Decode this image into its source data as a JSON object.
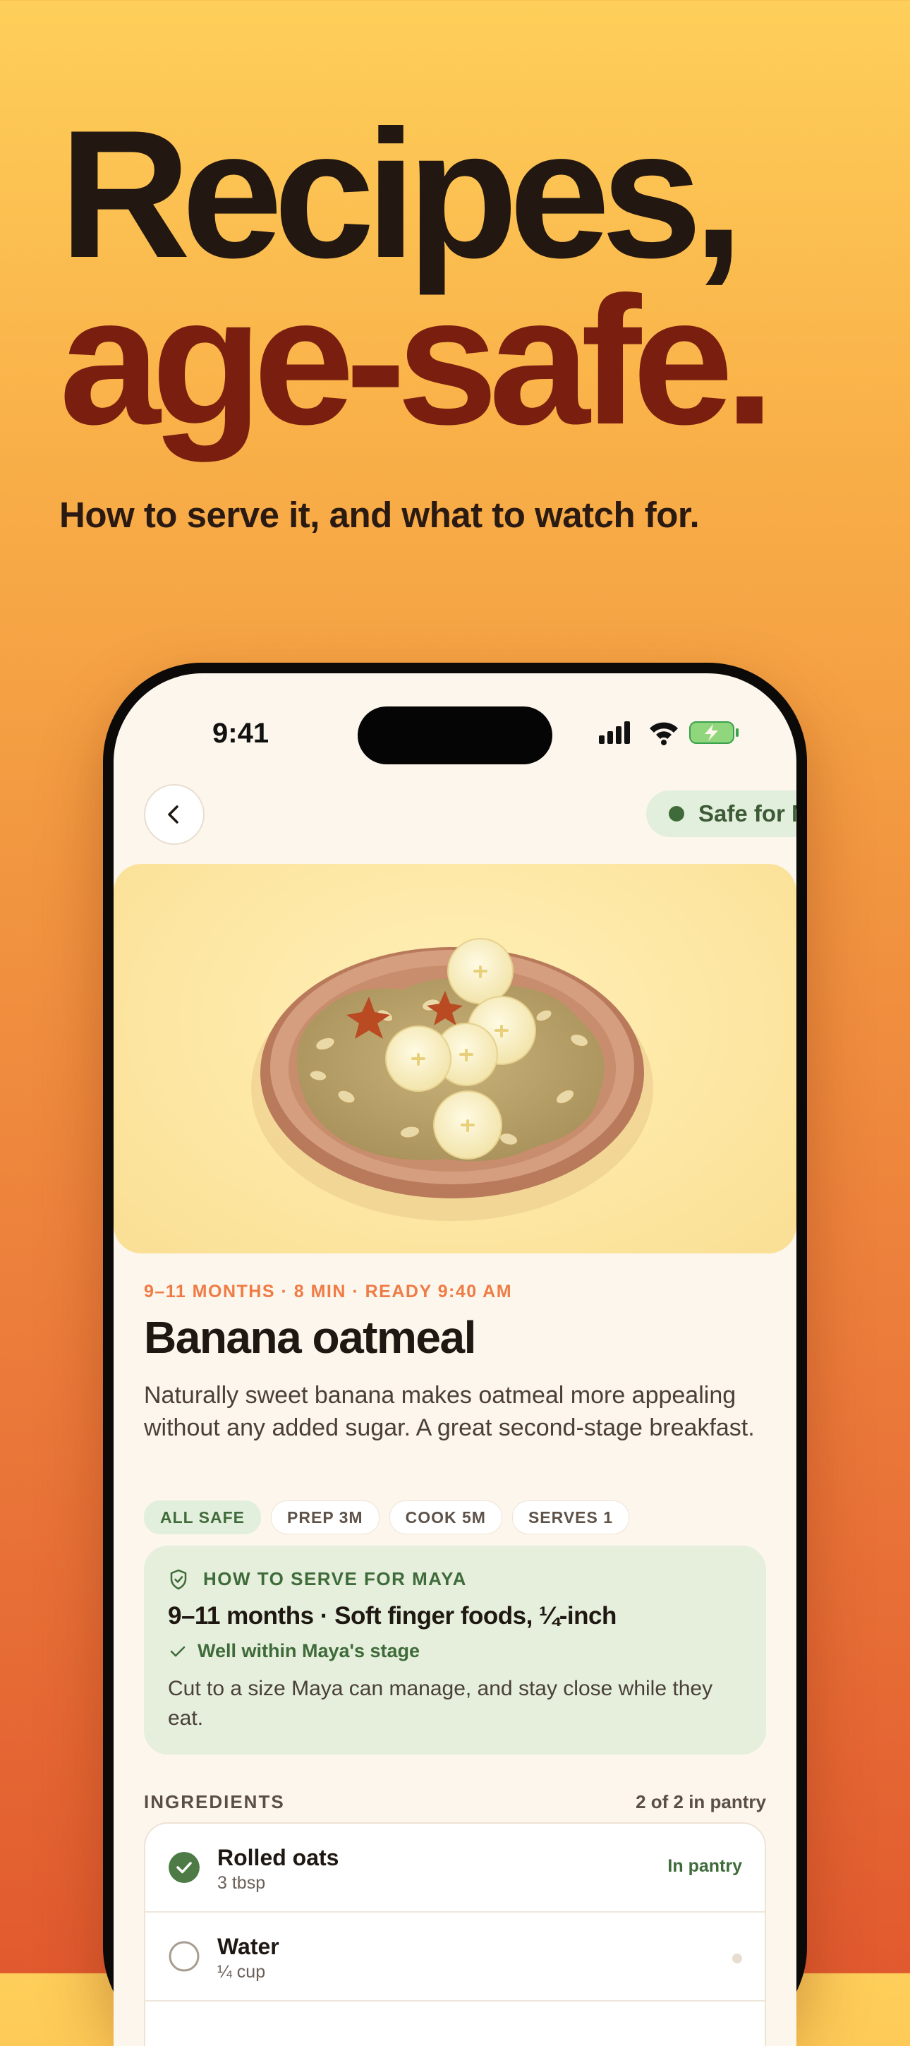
{
  "promo": {
    "headline_line1": "Recipes,",
    "headline_line2": "age-safe.",
    "subhead": "How to serve it, and what to watch for."
  },
  "status_bar": {
    "time": "9:41"
  },
  "nav": {
    "safe_badge": "Safe for Maya"
  },
  "recipe": {
    "meta": "9–11 MONTHS · 8 MIN · READY 9:40 AM",
    "title": "Banana oatmeal",
    "description": "Naturally sweet banana makes oatmeal more appealing without any added sugar. A great second-stage breakfast.",
    "chips": [
      "ALL SAFE",
      "PREP 3M",
      "COOK 5M",
      "SERVES 1"
    ]
  },
  "serve_card": {
    "heading": "HOW TO SERVE FOR MAYA",
    "title": "9–11 months · Soft finger foods, ¼-inch",
    "check": "Well within Maya's stage",
    "body": "Cut to a size Maya can manage, and stay close while they eat."
  },
  "ingredients": {
    "label": "INGREDIENTS",
    "count": "2 of 2 in pantry",
    "items": [
      {
        "name": "Rolled oats",
        "qty": "3 tbsp",
        "state": "In pantry"
      },
      {
        "name": "Water",
        "qty": "¼ cup",
        "state": ""
      }
    ]
  },
  "colors": {
    "headline_dark": "#221711",
    "headline_red": "#7a1f0f",
    "accent_orange": "#ef7b45",
    "safe_green": "#3f6b3a",
    "card_green": "#e5efdc"
  },
  "icons": [
    "back-chevron-icon",
    "cellular-signal-icon",
    "wifi-icon",
    "battery-charging-icon",
    "shield-check-icon",
    "check-icon",
    "checkmark-circle-icon",
    "empty-circle-icon"
  ]
}
